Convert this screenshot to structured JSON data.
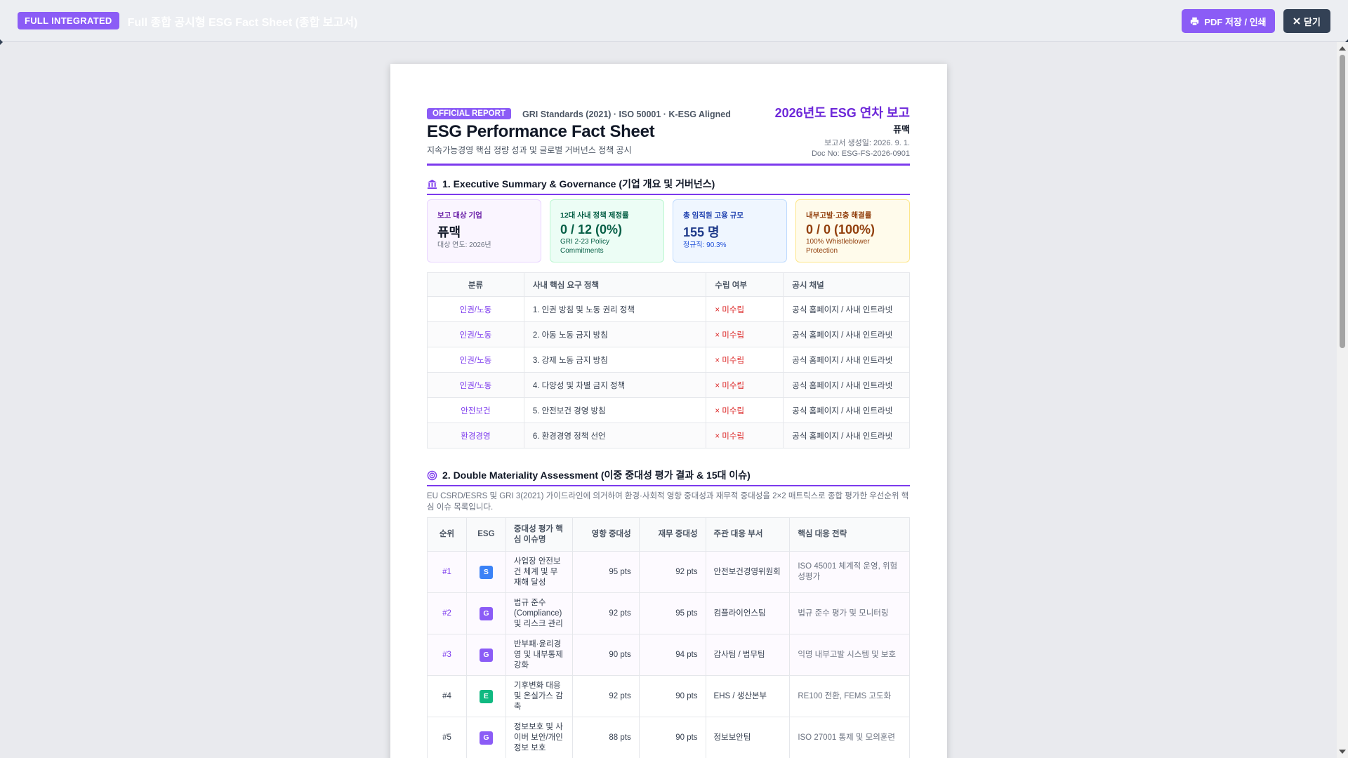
{
  "topbar": {
    "tag": "FULL INTEGRATED",
    "title": "Full 종합 공시형 ESG Fact Sheet (종합 보고서)",
    "pdf_label": "PDF 저장 / 인쇄",
    "close_label": "닫기",
    "pdf_icon": "printer-icon",
    "close_icon": "x-icon"
  },
  "report": {
    "badge": "OFFICIAL REPORT",
    "standards": "GRI Standards (2021) · ISO 50001 · K-ESG Aligned",
    "title": "ESG Performance Fact Sheet",
    "subtitle": "지속가능경영 핵심 정량 성과 및 글로벌 거버넌스 정책 공시",
    "year_title": "2026년도 ESG 연차 보고",
    "company": "퓨맥",
    "generated": "보고서 생성일: 2026. 9. 1.",
    "doc_no": "Doc No: ESG-FS-2026-0901"
  },
  "section1": {
    "title": "1. Executive Summary & Governance (기업 개요 및 거버넌스)",
    "icon": "bank-icon",
    "cards": [
      {
        "label": "보고 대상 기업",
        "value": "퓨맥",
        "note": "대상 연도: 2026년"
      },
      {
        "label": "12대 사내 정책 제정률",
        "value": "0 / 12 (0%)",
        "note": "GRI 2-23 Policy Commitments"
      },
      {
        "label": "총 임직원 고용 규모",
        "value": "155 명",
        "note": "정규직: 90.3%"
      },
      {
        "label": "내부고발·고충 해결률",
        "value": "0 / 0 (100%)",
        "note": "100% Whistleblower Protection"
      }
    ],
    "policy_headers": [
      "분류",
      "사내 핵심 요구 정책",
      "수립 여부",
      "공시 채널"
    ],
    "policy_rows": [
      {
        "category": "인권/노동",
        "policy": "1. 인권 방침 및 노동 권리 정책",
        "status": "× 미수립",
        "channel": "공식 홈페이지 / 사내 인트라넷"
      },
      {
        "category": "인권/노동",
        "policy": "2. 아동 노동 금지 방침",
        "status": "× 미수립",
        "channel": "공식 홈페이지 / 사내 인트라넷"
      },
      {
        "category": "인권/노동",
        "policy": "3. 강제 노동 금지 방침",
        "status": "× 미수립",
        "channel": "공식 홈페이지 / 사내 인트라넷"
      },
      {
        "category": "인권/노동",
        "policy": "4. 다양성 및 차별 금지 정책",
        "status": "× 미수립",
        "channel": "공식 홈페이지 / 사내 인트라넷"
      },
      {
        "category": "안전보건",
        "policy": "5. 안전보건 경영 방침",
        "status": "× 미수립",
        "channel": "공식 홈페이지 / 사내 인트라넷"
      },
      {
        "category": "환경경영",
        "policy": "6. 환경경영 정책 선언",
        "status": "× 미수립",
        "channel": "공식 홈페이지 / 사내 인트라넷"
      }
    ]
  },
  "section2": {
    "title": "2. Double Materiality Assessment (이중 중대성 평가 결과 & 15대 이슈)",
    "icon": "target-icon",
    "description": "EU CSRD/ESRS 및 GRI 3(2021) 가이드라인에 의거하여 환경·사회적 영향 중대성과 재무적 중대성을 2×2 매트릭스로 종합 평가한 우선순위 핵심 이슈 목록입니다.",
    "headers": [
      "순위",
      "ESG",
      "중대성 평가 핵심 이슈명",
      "영향 중대성",
      "재무 중대성",
      "주관 대응 부서",
      "핵심 대응 전략"
    ],
    "rows": [
      {
        "rank": "#1",
        "esg": "S",
        "issue": "사업장 안전보건 체계 및 무재해 달성",
        "impact": "95 pts",
        "financial": "92 pts",
        "dept": "안전보건경영위원회",
        "strategy": "ISO 45001 체계적 운영, 위험성평가"
      },
      {
        "rank": "#2",
        "esg": "G",
        "issue": "법규 준수(Compliance) 및 리스크 관리",
        "impact": "92 pts",
        "financial": "95 pts",
        "dept": "컴플라이언스팀",
        "strategy": "법규 준수 평가 및 모니터링"
      },
      {
        "rank": "#3",
        "esg": "G",
        "issue": "반부패·윤리경영 및 내부통제 강화",
        "impact": "90 pts",
        "financial": "94 pts",
        "dept": "감사팀 / 법무팀",
        "strategy": "익명 내부고발 시스템 및 보호"
      },
      {
        "rank": "#4",
        "esg": "E",
        "issue": "기후변화 대응 및 온실가스 감축",
        "impact": "92 pts",
        "financial": "90 pts",
        "dept": "EHS / 생산본부",
        "strategy": "RE100 전환, FEMS 고도화"
      },
      {
        "rank": "#5",
        "esg": "G",
        "issue": "정보보호 및 사이버 보안/개인정보 보호",
        "impact": "88 pts",
        "financial": "90 pts",
        "dept": "정보보안팀",
        "strategy": "ISO 27001 통제 및 모의훈련"
      }
    ]
  },
  "colors": {
    "accent": "#8b5cf6",
    "accent_dark": "#7c3aed",
    "close_button": "#334155",
    "missing": "#dc2626",
    "social": "#3b82f6",
    "governance": "#8b5cf6",
    "environment": "#10b981"
  }
}
